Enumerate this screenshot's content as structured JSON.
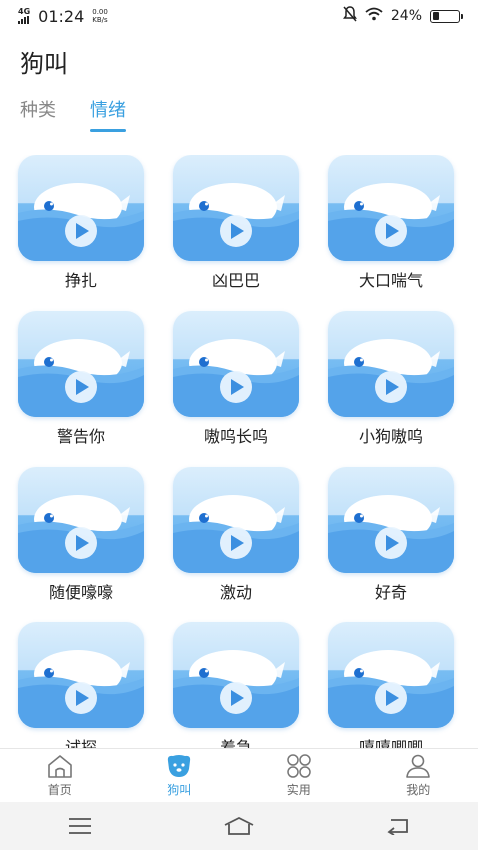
{
  "status": {
    "net": "4G",
    "time": "01:24",
    "speed_value": "0.00",
    "speed_unit": "KB/s",
    "battery": "24%"
  },
  "page_title": "狗叫",
  "tabs": [
    {
      "label": "种类"
    },
    {
      "label": "情绪"
    }
  ],
  "items": [
    {
      "label": "挣扎"
    },
    {
      "label": "凶巴巴"
    },
    {
      "label": "大口喘气"
    },
    {
      "label": "警告你"
    },
    {
      "label": "嗷呜长呜"
    },
    {
      "label": "小狗嗷呜"
    },
    {
      "label": "随便嚎嚎"
    },
    {
      "label": "激动"
    },
    {
      "label": "好奇"
    },
    {
      "label": "试探"
    },
    {
      "label": "着急"
    },
    {
      "label": "嘻嘻唧唧"
    }
  ],
  "bottom_nav": [
    {
      "label": "首页"
    },
    {
      "label": "狗叫"
    },
    {
      "label": "实用"
    },
    {
      "label": "我的"
    }
  ],
  "colors": {
    "accent": "#3aa0e0",
    "water": "#5aa9ee"
  }
}
